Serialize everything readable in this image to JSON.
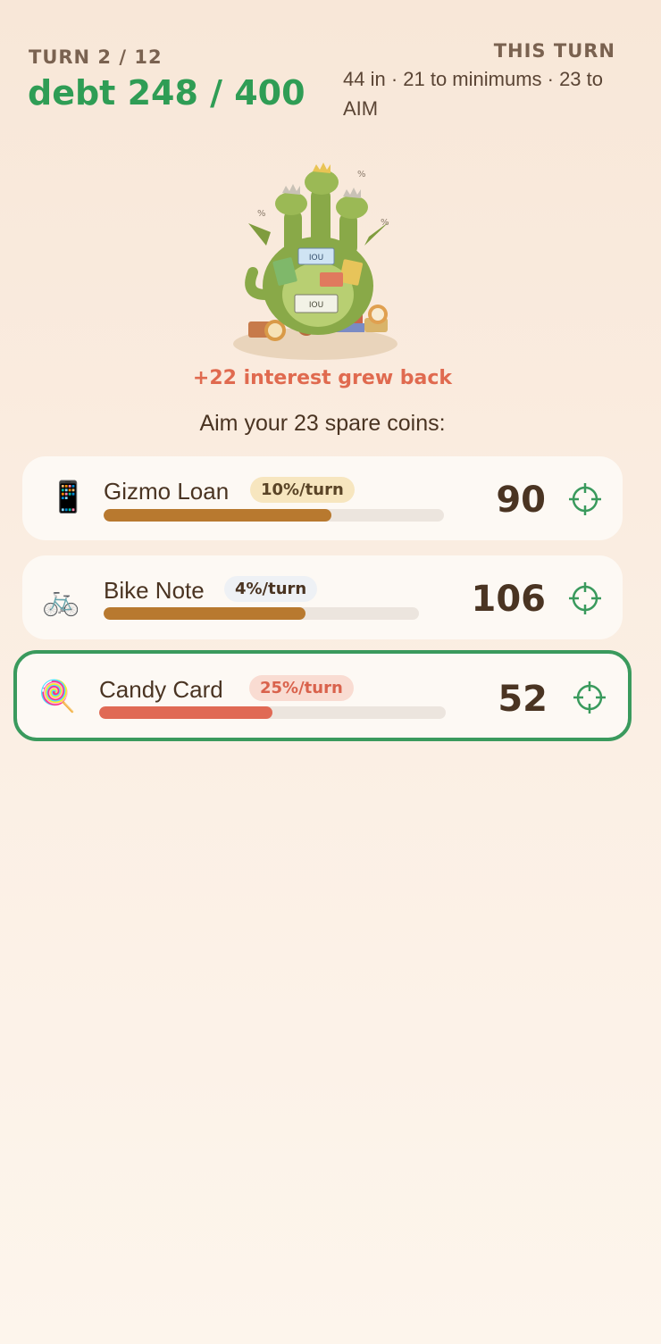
{
  "header": {
    "turn": "TURN 2 / 12",
    "debt": "debt 248 / 400",
    "this_turn_label": "THIS TURN",
    "this_turn_text": "44 in · 21 to minimums · 23 to AIM"
  },
  "hero_icon": "dragon-hoard-icon",
  "interest_message": "+22 interest grew back",
  "aim_prompt": "Aim your 23 spare coins:",
  "debts": [
    {
      "icon": "phone-icon",
      "name": "Gizmo Loan",
      "rate": "10%/turn",
      "amount": "90",
      "progress": 0.67,
      "bar_color": "#b8792f",
      "selected": false
    },
    {
      "icon": "bicycle-icon",
      "name": "Bike Note",
      "rate": "4%/turn",
      "amount": "106",
      "progress": 0.64,
      "bar_color": "#b8792f",
      "selected": false
    },
    {
      "icon": "lollipop-icon",
      "name": "Candy Card",
      "rate": "25%/turn",
      "amount": "52",
      "progress": 0.5,
      "bar_color": "#e06a55",
      "selected": true
    }
  ],
  "colors": {
    "accent": "#2f9d55",
    "interest": "#e06a4f",
    "selected_border": "#3a9a5d"
  }
}
